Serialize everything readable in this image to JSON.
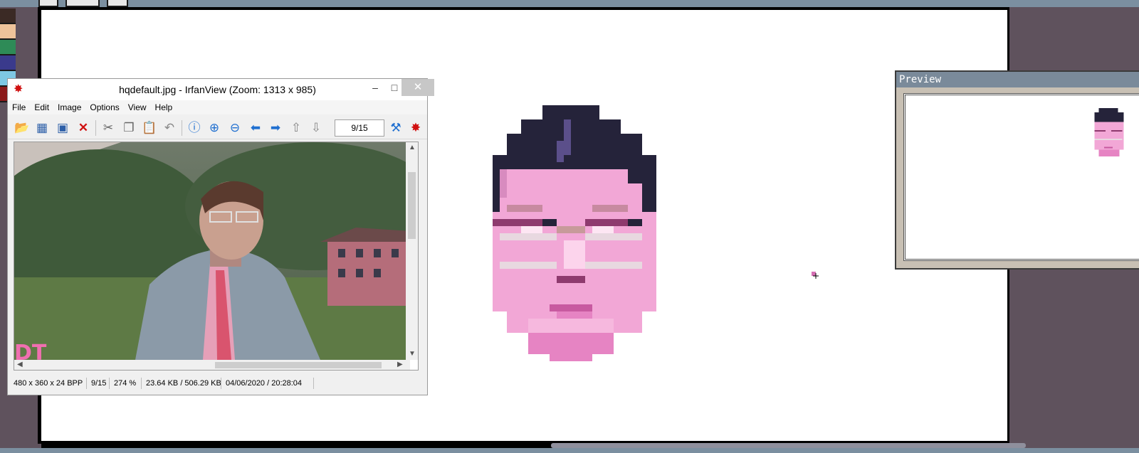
{
  "irfanview": {
    "title": "hqdefault.jpg - IrfanView (Zoom: 1313 x 985)",
    "menu": [
      "File",
      "Edit",
      "Image",
      "Options",
      "View",
      "Help"
    ],
    "page_counter": "9/15",
    "status": {
      "dimensions": "480 x 360 x 24 BPP",
      "page": "9/15",
      "zoom": "274 %",
      "size": "23.64 KB / 506.29 KB",
      "datetime": "04/06/2020 / 20:28:04"
    },
    "window_controls": {
      "minimize": "–",
      "maximize": "□",
      "close": "✕"
    }
  },
  "preview": {
    "title": "Preview"
  },
  "palette_colors": [
    "#3b2a25",
    "#eec39a",
    "#2e8b57",
    "#3a3a8c",
    "#7ec8e3",
    "#8b1a1a"
  ],
  "icons": [
    "open-folder-icon",
    "thumbnails-icon",
    "save-icon",
    "delete-icon",
    "cut-icon",
    "copy-icon",
    "paste-icon",
    "undo-icon",
    "info-icon",
    "zoom-in-icon",
    "zoom-out-icon",
    "prev-icon",
    "next-icon",
    "page-up-icon",
    "page-down-icon",
    "settings-icon",
    "paint-icon"
  ]
}
